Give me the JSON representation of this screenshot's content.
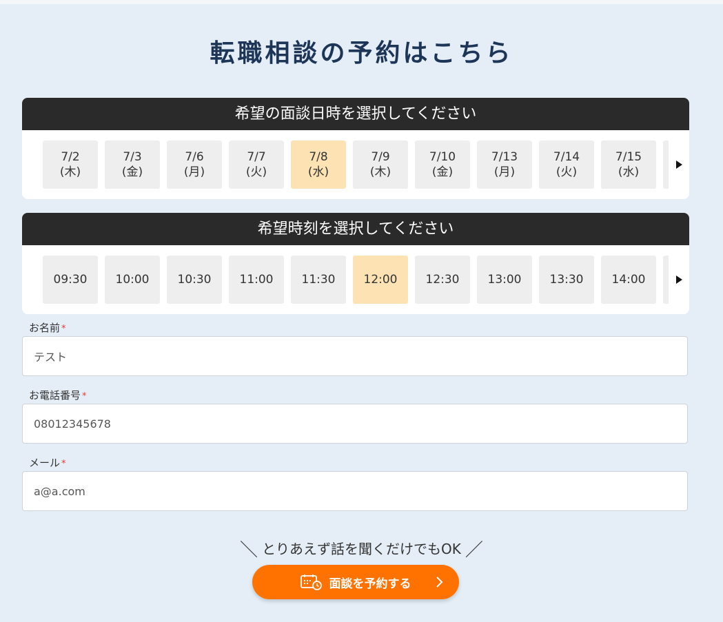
{
  "page": {
    "title": "転職相談の予約はこちら"
  },
  "date_panel": {
    "heading": "希望の面談日時を選択してください",
    "dates": [
      {
        "date": "7/2",
        "day": "(木)"
      },
      {
        "date": "7/3",
        "day": "(金)"
      },
      {
        "date": "7/6",
        "day": "(月)"
      },
      {
        "date": "7/7",
        "day": "(火)"
      },
      {
        "date": "7/8",
        "day": "(水)"
      },
      {
        "date": "7/9",
        "day": "(木)"
      },
      {
        "date": "7/10",
        "day": "(金)"
      },
      {
        "date": "7/13",
        "day": "(月)"
      },
      {
        "date": "7/14",
        "day": "(火)"
      },
      {
        "date": "7/15",
        "day": "(水)"
      }
    ],
    "selected_date": "7/8"
  },
  "time_panel": {
    "heading": "希望時刻を選択してください",
    "times": [
      "09:30",
      "10:00",
      "10:30",
      "11:00",
      "11:30",
      "12:00",
      "12:30",
      "13:00",
      "13:30",
      "14:00"
    ],
    "selected_time": "12:00"
  },
  "form": {
    "name": {
      "label": "お名前",
      "required_mark": "*",
      "value": "テスト"
    },
    "phone": {
      "label": "お電話番号",
      "required_mark": "*",
      "value": "08012345678"
    },
    "email": {
      "label": "メール",
      "required_mark": "*",
      "value": "a@a.com"
    }
  },
  "cta": {
    "tagline": "とりあえず話を聞くだけでもOK",
    "tagline_left": "＼",
    "tagline_right": "／",
    "button_label": "面談を予約する",
    "icon": "calendar-clock-icon"
  },
  "colors": {
    "background": "#e5eef7",
    "title": "#1d3557",
    "panel_header": "#2a2a2a",
    "slot": "#eeeeee",
    "slot_selected": "#fde3b3",
    "cta": "#ff7200",
    "required": "#e53935"
  }
}
